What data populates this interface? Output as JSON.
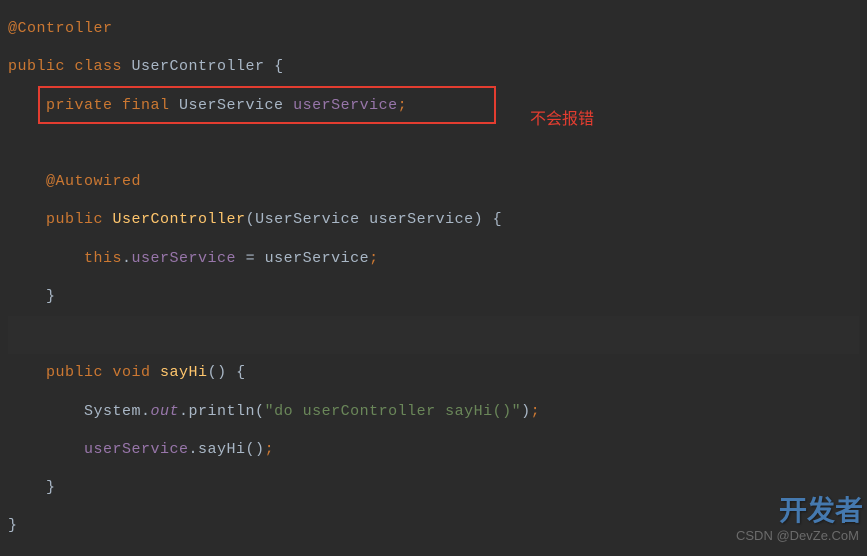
{
  "code": {
    "l1_annotation": "@Controller",
    "l2_public": "public ",
    "l2_class": "class ",
    "l2_name": "UserController ",
    "l2_brace": "{",
    "l3_private": "private ",
    "l3_final": "final ",
    "l3_type": "UserService ",
    "l3_field": "userService",
    "l3_semi": ";",
    "l5_annotation": "@Autowired",
    "l6_public": "public ",
    "l6_ctor": "UserController",
    "l6_paren_open": "(",
    "l6_ptype": "UserService ",
    "l6_pname": "userService",
    "l6_paren_close": ") ",
    "l6_brace": "{",
    "l7_this": "this",
    "l7_dot": ".",
    "l7_field": "userService",
    "l7_eq": " = ",
    "l7_param": "userService",
    "l7_semi": ";",
    "l8_brace": "}",
    "l10_public": "public ",
    "l10_void": "void ",
    "l10_method": "sayHi",
    "l10_parens": "() ",
    "l10_brace": "{",
    "l11_system": "System.",
    "l11_out": "out",
    "l11_println": ".println(",
    "l11_string": "\"do userController sayHi()\"",
    "l11_close": ")",
    "l11_semi": ";",
    "l12_field": "userService",
    "l12_method": ".sayHi()",
    "l12_semi": ";",
    "l13_brace": "}",
    "l14_brace": "}"
  },
  "annotation_text": "不会报错",
  "watermark_logo": "开发者",
  "watermark_text": "CSDN @DevZe.CoM"
}
